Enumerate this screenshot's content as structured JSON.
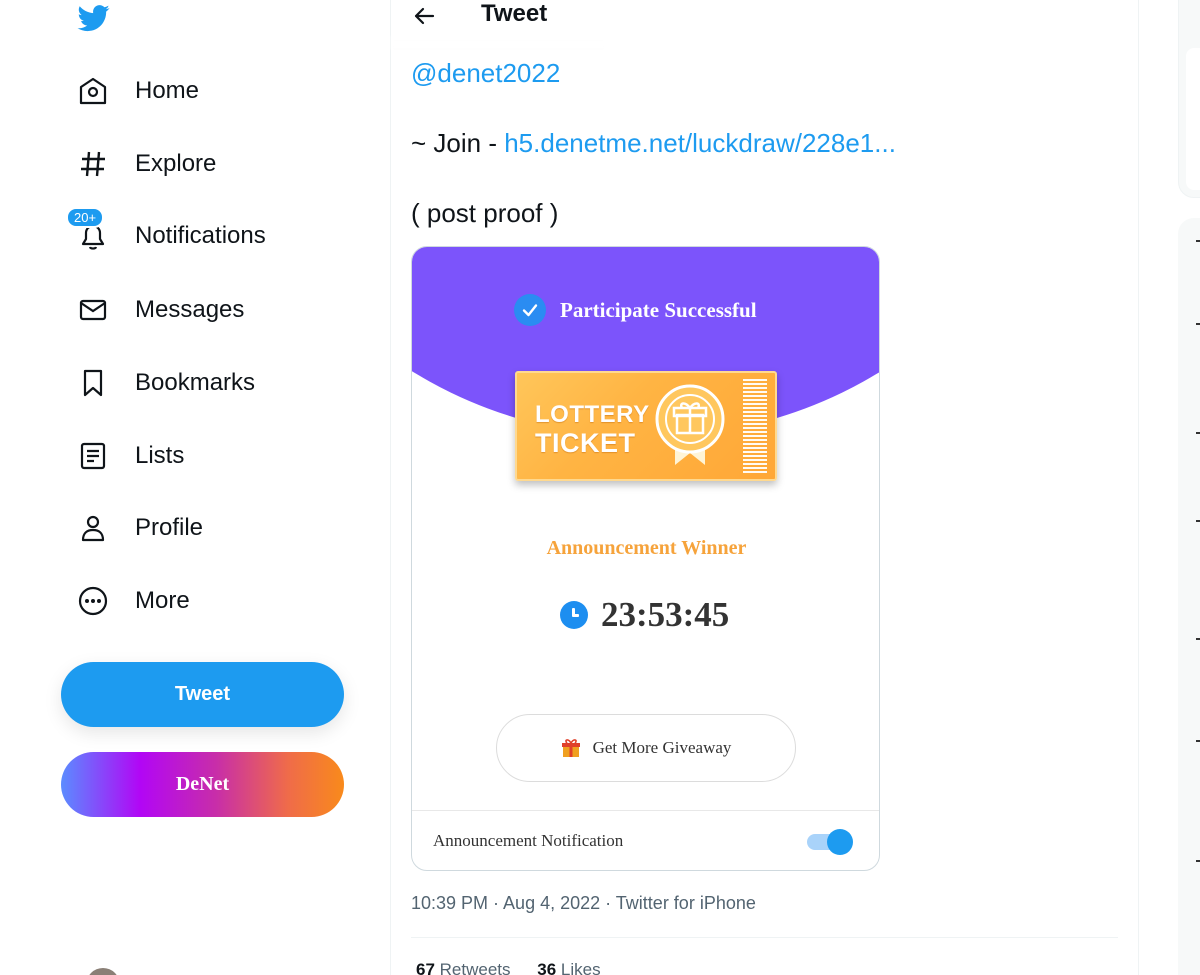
{
  "sidebar": {
    "items": [
      {
        "label": "Home",
        "icon": "home-icon"
      },
      {
        "label": "Explore",
        "icon": "hashtag-icon"
      },
      {
        "label": "Notifications",
        "icon": "bell-icon",
        "badge": "20+"
      },
      {
        "label": "Messages",
        "icon": "envelope-icon"
      },
      {
        "label": "Bookmarks",
        "icon": "bookmark-icon"
      },
      {
        "label": "Lists",
        "icon": "list-icon"
      },
      {
        "label": "Profile",
        "icon": "person-icon"
      },
      {
        "label": "More",
        "icon": "more-circle-icon"
      }
    ],
    "tweet_button": "Tweet",
    "denet_button": "DeNet"
  },
  "header": {
    "title": "Tweet"
  },
  "tweet": {
    "mention": "@denet2022",
    "join_prefix": "~ Join - ",
    "join_link": "h5.denetme.net/luckdraw/228e1...",
    "proof": "( post proof )",
    "card": {
      "participate": "Participate Successful",
      "ticket_line1": "LOTTERY",
      "ticket_line2": "TICKET",
      "announcement_winner": "Announcement Winner",
      "countdown": "23:53:45",
      "giveaway_button": "Get More Giveaway",
      "notification_label": "Announcement Notification",
      "notification_on": true
    },
    "meta": "10:39 PM · Aug 4, 2022 · Twitter for iPhone",
    "retweets_count": "67",
    "retweets_label": "Retweets",
    "likes_count": "36",
    "likes_label": "Likes"
  },
  "colors": {
    "accent": "#1d9bf0",
    "purple": "#7c54fb",
    "ticket_orange": "#ffb443",
    "winner_orange": "#f6a33b"
  }
}
